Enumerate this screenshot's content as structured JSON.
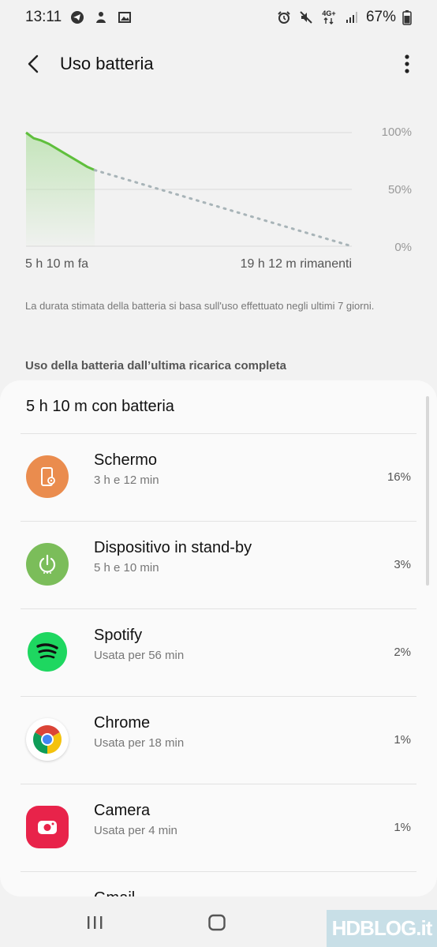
{
  "status_bar": {
    "time": "13:11",
    "network": "4G+",
    "battery_percent": "67%",
    "left_icons": [
      "telegram-icon",
      "notification-icon",
      "image-icon"
    ],
    "right_icons": [
      "alarm-icon",
      "mute-icon",
      "data-arrows-icon",
      "signal-icon",
      "battery-icon"
    ]
  },
  "app_bar": {
    "title": "Uso batteria"
  },
  "chart": {
    "start_label": "5 h 10 m fa",
    "end_label": "19 h 12 m rimanenti",
    "y_ticks": [
      "100%",
      "50%",
      "0%"
    ]
  },
  "chart_data": {
    "type": "line",
    "series": [
      {
        "values": [
          100,
          95,
          93,
          90,
          86,
          82,
          78,
          74,
          70,
          67
        ]
      },
      {
        "values": [
          67,
          0
        ]
      }
    ],
    "ylim": [
      0,
      100
    ]
  },
  "note": "La durata stimata della batteria si basa sull'uso effettuato negli ultimi 7 giorni.",
  "section_header": "Uso della batteria dall’ultima ricarica completa",
  "card": {
    "title": "5 h 10 m con batteria",
    "rows": [
      {
        "name": "Schermo",
        "sub": "3 h e 12 min",
        "pct": "16%",
        "icon": "screen-icon",
        "color": "#ea8c4e"
      },
      {
        "name": "Dispositivo in stand-by",
        "sub": "5 h e 10 min",
        "pct": "3%",
        "icon": "power-icon",
        "color": "#7bbd5a"
      },
      {
        "name": "Spotify",
        "sub": "Usata per 56 min",
        "pct": "2%",
        "icon": "spotify-icon",
        "color": "#1ed760"
      },
      {
        "name": "Chrome",
        "sub": "Usata per 18 min",
        "pct": "1%",
        "icon": "chrome-icon",
        "color": "#ffffff"
      },
      {
        "name": "Camera",
        "sub": "Usata per 4 min",
        "pct": "1%",
        "icon": "camera-icon",
        "color": "#e8234a"
      },
      {
        "name": "Gmail",
        "sub": "",
        "pct": "",
        "icon": "gmail-icon",
        "color": "#ffffff"
      }
    ]
  },
  "nav_bar": {
    "icons": [
      "recent-apps-icon",
      "home-icon",
      "back-icon"
    ]
  },
  "watermark": {
    "text": "HDBLOG.it"
  },
  "colors": {
    "accent_green": "#5fbf3c",
    "background": "#f2f2f2",
    "card": "#fafafa"
  }
}
